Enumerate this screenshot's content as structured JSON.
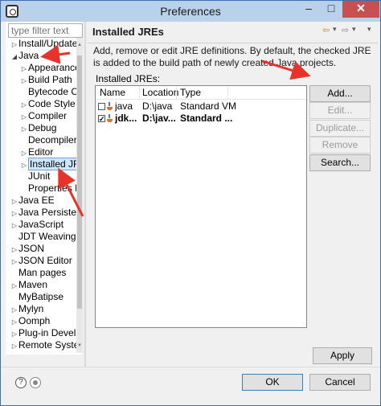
{
  "window": {
    "title": "Preferences",
    "controls": {
      "minimize": "–",
      "maximize": "□",
      "close": "✕"
    }
  },
  "sidebar": {
    "filter_placeholder": "type filter text",
    "items": [
      {
        "label": "Install/Update",
        "expander": "closed",
        "depth": 0,
        "selected": false
      },
      {
        "label": "Java",
        "expander": "open",
        "depth": 0,
        "selected": false
      },
      {
        "label": "Appearance",
        "expander": "closed",
        "depth": 1,
        "selected": false
      },
      {
        "label": "Build Path",
        "expander": "closed",
        "depth": 1,
        "selected": false
      },
      {
        "label": "Bytecode C",
        "expander": "none",
        "depth": 1,
        "selected": false
      },
      {
        "label": "Code Style",
        "expander": "closed",
        "depth": 1,
        "selected": false
      },
      {
        "label": "Compiler",
        "expander": "closed",
        "depth": 1,
        "selected": false
      },
      {
        "label": "Debug",
        "expander": "closed",
        "depth": 1,
        "selected": false
      },
      {
        "label": "Decompiler",
        "expander": "none",
        "depth": 1,
        "selected": false
      },
      {
        "label": "Editor",
        "expander": "closed",
        "depth": 1,
        "selected": false
      },
      {
        "label": "Installed JR",
        "expander": "closed",
        "depth": 1,
        "selected": true
      },
      {
        "label": "JUnit",
        "expander": "none",
        "depth": 1,
        "selected": false
      },
      {
        "label": "Properties I",
        "expander": "none",
        "depth": 1,
        "selected": false
      },
      {
        "label": "Java EE",
        "expander": "closed",
        "depth": 0,
        "selected": false
      },
      {
        "label": "Java Persisten",
        "expander": "closed",
        "depth": 0,
        "selected": false
      },
      {
        "label": "JavaScript",
        "expander": "closed",
        "depth": 0,
        "selected": false
      },
      {
        "label": "JDT Weaving",
        "expander": "none",
        "depth": 0,
        "selected": false
      },
      {
        "label": "JSON",
        "expander": "closed",
        "depth": 0,
        "selected": false
      },
      {
        "label": "JSON Editor",
        "expander": "closed",
        "depth": 0,
        "selected": false
      },
      {
        "label": "Man pages",
        "expander": "none",
        "depth": 0,
        "selected": false
      },
      {
        "label": "Maven",
        "expander": "closed",
        "depth": 0,
        "selected": false
      },
      {
        "label": "MyBatipse",
        "expander": "none",
        "depth": 0,
        "selected": false
      },
      {
        "label": "Mylyn",
        "expander": "closed",
        "depth": 0,
        "selected": false
      },
      {
        "label": "Oomph",
        "expander": "closed",
        "depth": 0,
        "selected": false
      },
      {
        "label": "Plug-in Devel",
        "expander": "closed",
        "depth": 0,
        "selected": false
      },
      {
        "label": "Remote Syste",
        "expander": "closed",
        "depth": 0,
        "selected": false
      }
    ]
  },
  "main": {
    "title": "Installed JREs",
    "nav": {
      "back": "⇦",
      "back_menu": "▾",
      "forward": "⇨",
      "forward_menu": "▾",
      "menu": "▾"
    },
    "description": "Add, remove or edit JRE definitions. By default, the checked JRE is added to the build path of newly created Java projects.",
    "list_label": "Installed JREs:",
    "columns": [
      "Name",
      "Location",
      "Type"
    ],
    "rows": [
      {
        "checked": false,
        "name": "java",
        "location": "D:\\java",
        "type": "Standard VM"
      },
      {
        "checked": true,
        "name": "jdk...",
        "location": "D:\\jav...",
        "type": "Standard ..."
      }
    ],
    "buttons": {
      "add": "Add...",
      "edit": "Edit...",
      "duplicate": "Duplicate...",
      "remove": "Remove",
      "search": "Search..."
    },
    "apply": "Apply"
  },
  "footer": {
    "ok": "OK",
    "cancel": "Cancel",
    "help_glyph": "?"
  },
  "colors": {
    "annotation_arrow": "#e8322c",
    "close_button": "#c75050",
    "selection": "#cce8ff"
  }
}
